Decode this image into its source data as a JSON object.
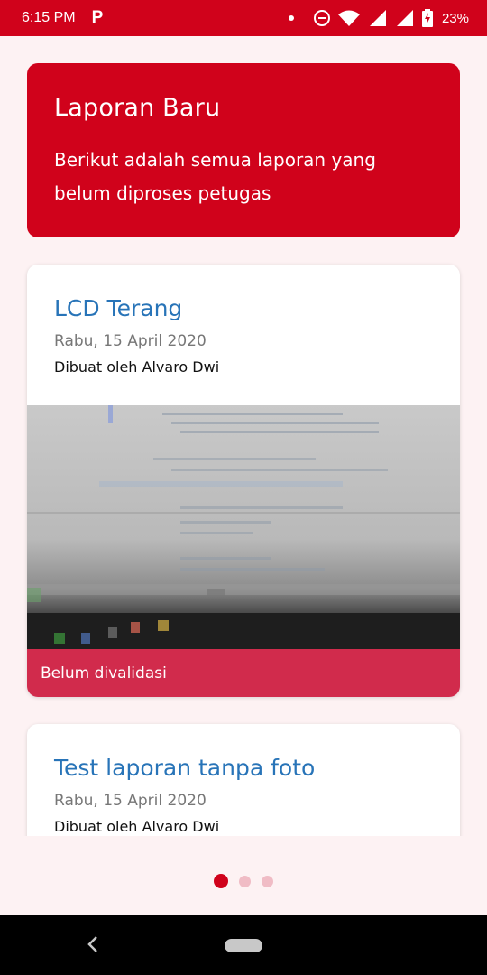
{
  "status_bar": {
    "time": "6:15 PM",
    "app_icon": "P",
    "battery": "23%",
    "icons": [
      "notification-dot-icon",
      "do-not-disturb-icon",
      "wifi-icon",
      "signal-icon",
      "signal-icon",
      "battery-charging-icon"
    ]
  },
  "header": {
    "title": "Laporan Baru",
    "subtitle": "Berikut adalah semua laporan yang belum diproses petugas"
  },
  "reports": [
    {
      "title": "LCD Terang",
      "date": "Rabu, 15 April 2020",
      "author": "Dibuat oleh Alvaro Dwi",
      "status": "Belum divalidasi"
    },
    {
      "title": "Test laporan tanpa foto",
      "date": "Rabu, 15 April 2020",
      "author": "Dibuat oleh Alvaro Dwi"
    }
  ],
  "pager": {
    "count": 3,
    "active_index": 0
  },
  "colors": {
    "primary": "#d0021b",
    "title_blue": "#2874b8",
    "status_badge": "#d12b4c",
    "background": "#fdf2f3"
  },
  "nav_bar": {
    "icons": [
      "back-icon",
      "home-pill-icon"
    ]
  }
}
